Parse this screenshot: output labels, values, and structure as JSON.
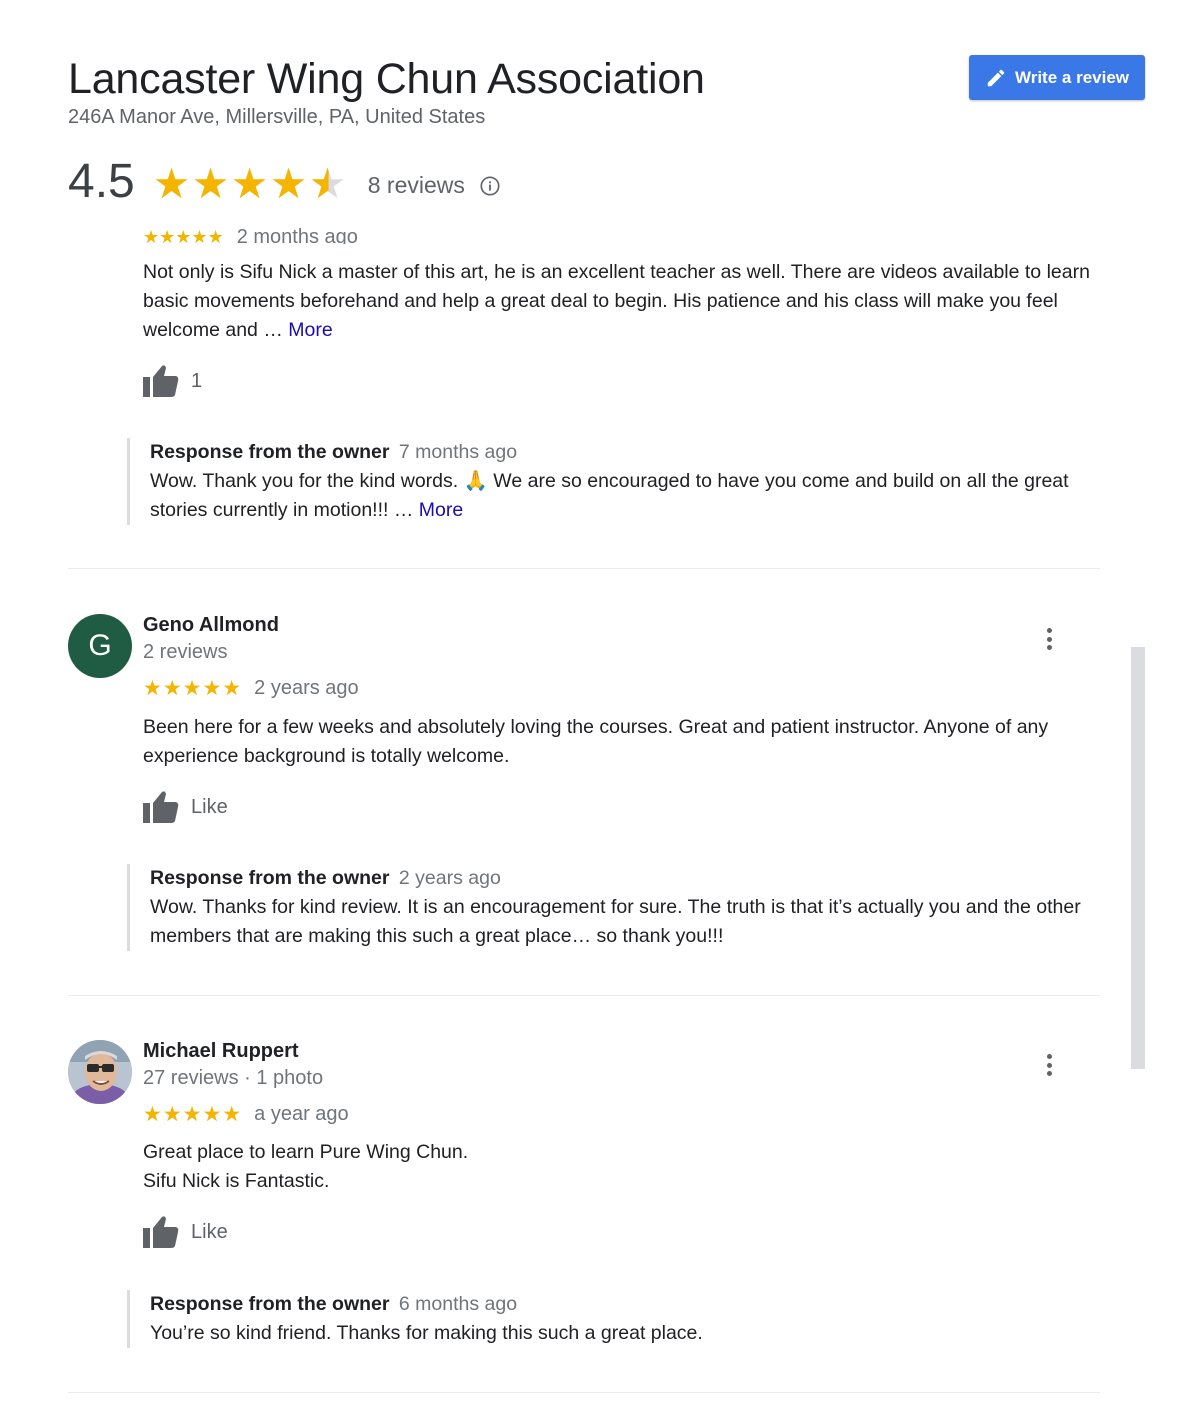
{
  "business": {
    "name": "Lancaster Wing Chun Association",
    "address": "246A Manor Ave, Millersville, PA, United States",
    "rating": "4.5",
    "rating_fraction": 0.9,
    "reviews_count": "8 reviews"
  },
  "header": {
    "write_review_label": "Write a review"
  },
  "icons": {
    "edit": "pencil-icon",
    "info": "info-icon",
    "like": "thumb-up-icon",
    "menu": "more-vert-icon"
  },
  "colors": {
    "star": "#f4b400",
    "button": "#3b78e7",
    "link": "#1a0dab",
    "avatar_g": "#1f5c43"
  },
  "review1": {
    "stars": "★★★★★",
    "time_partial": "2 months ago",
    "text": "Not only is Sifu Nick a master of this art, he is an excellent teacher as well.  There are videos available to learn basic movements beforehand and help a great deal to begin.   His patience and his class will make you feel welcome and …",
    "more": "More",
    "likes": "1",
    "owner_label": "Response from the owner",
    "owner_time": "7 months ago",
    "owner_text": "Wow. Thank you for the kind words. 🙏 We are so encouraged to have you come and build on all the great stories currently in motion!!! …",
    "owner_more": "More"
  },
  "review2": {
    "avatar_letter": "G",
    "name": "Geno Allmond",
    "meta": "2 reviews",
    "stars": "★★★★★",
    "time": "2 years ago",
    "text": "Been here for a few weeks and absolutely loving the courses. Great and patient instructor. Anyone of any experience background is totally welcome.",
    "like_label": "Like",
    "owner_label": "Response from the owner",
    "owner_time": "2 years ago",
    "owner_text": "Wow. Thanks for kind review. It is an encouragement for sure. The truth is that it’s actually you and the other members that are making this such a great place… so thank you!!!"
  },
  "review3": {
    "name": "Michael Ruppert",
    "meta": "27 reviews · 1 photo",
    "stars": "★★★★★",
    "time": "a year ago",
    "text_line1": "Great place to learn Pure Wing Chun.",
    "text_line2": "Sifu Nick is Fantastic.",
    "like_label": "Like",
    "owner_label": "Response from the owner",
    "owner_time": "6 months ago",
    "owner_text": "You’re so kind friend. Thanks for making this such a great place."
  }
}
